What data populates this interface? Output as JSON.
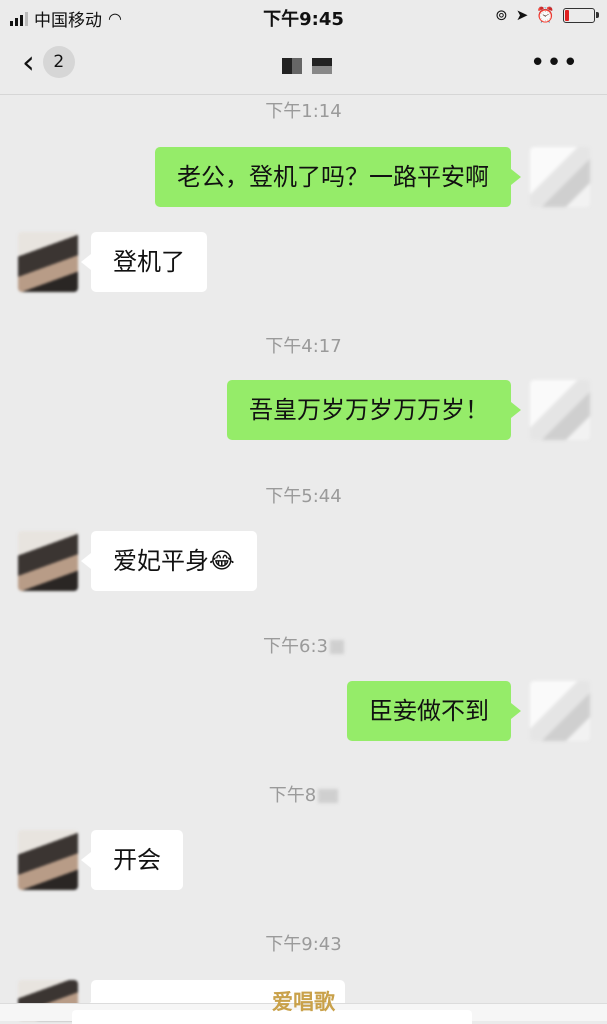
{
  "status": {
    "carrier": "中国移动",
    "time": "下午9:45"
  },
  "nav": {
    "back_badge": "2"
  },
  "timestamps": [
    "下午1:14",
    "下午4:17",
    "下午5:44",
    "下午6:3",
    "下午8",
    "下午9:43"
  ],
  "messages": [
    {
      "dir": "out",
      "text": "老公，登机了吗？一路平安啊"
    },
    {
      "dir": "in",
      "text": "登机了"
    },
    {
      "dir": "out",
      "text": "吾皇万岁万岁万万岁！"
    },
    {
      "dir": "in",
      "text": "爱妃平身",
      "emoji": "😂"
    },
    {
      "dir": "out",
      "text": "臣妾做不到"
    },
    {
      "dir": "in",
      "text": "开会"
    }
  ],
  "watermark": "爱唱歌",
  "colors": {
    "background": "#ebebeb",
    "outgoing_bubble": "#95ec69",
    "incoming_bubble": "#ffffff",
    "timestamp": "#9a9a9a"
  },
  "icons": [
    "wifi-icon",
    "lock-rotation-icon",
    "location-icon",
    "alarm-icon",
    "battery-icon",
    "chevron-left-icon",
    "more-icon"
  ]
}
